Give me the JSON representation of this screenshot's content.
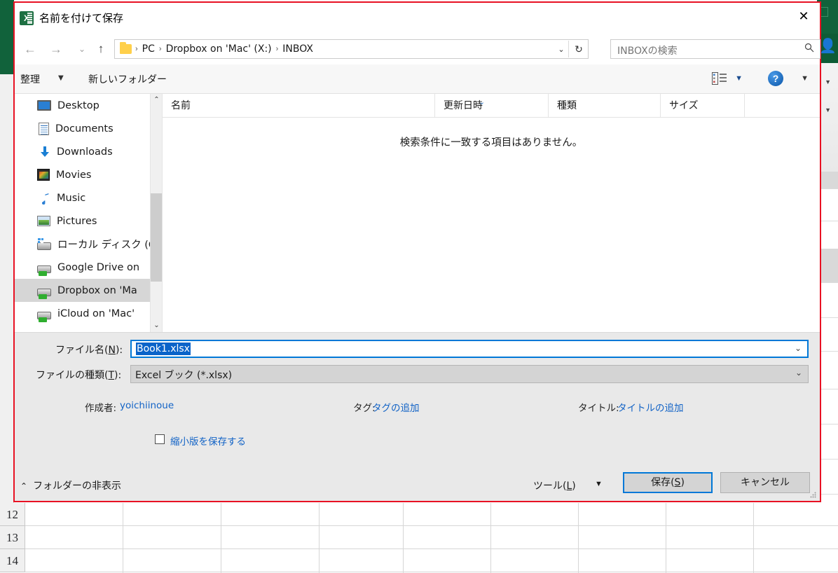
{
  "dialog": {
    "title": "名前を付けて保存",
    "app_icon": "excel-icon",
    "close_label": "✕"
  },
  "nav": {
    "back_label": "←",
    "forward_label": "→",
    "recent_label": "⌄",
    "up_label": "↑",
    "breadcrumbs": [
      "PC",
      "Dropbox on 'Mac' (X:)",
      "INBOX"
    ],
    "separator": "›",
    "address_caret": "⌄",
    "refresh_label": "↻"
  },
  "search": {
    "placeholder": "INBOXの検索",
    "icon": "🔎"
  },
  "toolbar": {
    "organize_label": "整理",
    "organize_caret": "▼",
    "new_folder_label": "新しいフォルダー",
    "view_caret": "▼",
    "help_label": "?",
    "more_caret": "▼"
  },
  "sidebar": {
    "items": [
      {
        "label": "Desktop",
        "icon": "desktop-icon",
        "selected": false
      },
      {
        "label": "Documents",
        "icon": "documents-icon",
        "selected": false
      },
      {
        "label": "Downloads",
        "icon": "downloads-icon",
        "selected": false
      },
      {
        "label": "Movies",
        "icon": "movies-icon",
        "selected": false
      },
      {
        "label": "Music",
        "icon": "music-icon",
        "selected": false
      },
      {
        "label": "Pictures",
        "icon": "pictures-icon",
        "selected": false
      },
      {
        "label": "ローカル ディスク (C",
        "icon": "local-disk-icon",
        "selected": false
      },
      {
        "label": "Google Drive on",
        "icon": "network-drive-icon",
        "selected": false
      },
      {
        "label": "Dropbox on 'Ma",
        "icon": "network-drive-icon",
        "selected": true
      },
      {
        "label": "iCloud on 'Mac'",
        "icon": "network-drive-icon",
        "selected": false
      }
    ],
    "scroll_up": "⌃",
    "scroll_down": "⌄"
  },
  "file_list": {
    "columns": [
      {
        "label": "名前",
        "sorted": false
      },
      {
        "label": "更新日時",
        "sorted": true
      },
      {
        "label": "種類",
        "sorted": false
      },
      {
        "label": "サイズ",
        "sorted": false
      }
    ],
    "sort_chevron": "⌄",
    "empty_message": "検索条件に一致する項目はありません。",
    "rows": []
  },
  "form": {
    "filename_label": "ファイル名(N):",
    "filename_value": "Book1.xlsx",
    "filetype_label": "ファイルの種類(T):",
    "filetype_value": "Excel ブック (*.xlsx)",
    "combo_caret": "⌄",
    "author_label": "作成者:",
    "author_value": "yoichiinoue",
    "tags_label": "タグ:",
    "tags_value": "タグの追加",
    "title_label": "タイトル:",
    "title_value": "タイトルの追加",
    "thumbnail_checkbox_label": "縮小版を保存する",
    "thumbnail_checked": false
  },
  "footer": {
    "hide_folders_caret": "⌃",
    "hide_folders_label": "フォルダーの非表示",
    "tools_label": "ツール(L)",
    "tools_caret": "▼",
    "save_label": "保存(S)",
    "cancel_label": "キャンセル"
  },
  "background": {
    "app": "Excel",
    "share_icon": "add-user-icon",
    "row_headers": [
      "12",
      "13",
      "14"
    ],
    "ribbon_caret": "▼"
  },
  "colors": {
    "excel_green": "#11623b",
    "dialog_border_red": "#e81123",
    "accent_blue": "#0078d7",
    "link_blue": "#1263c6",
    "selection_blue": "#0a63c9"
  }
}
